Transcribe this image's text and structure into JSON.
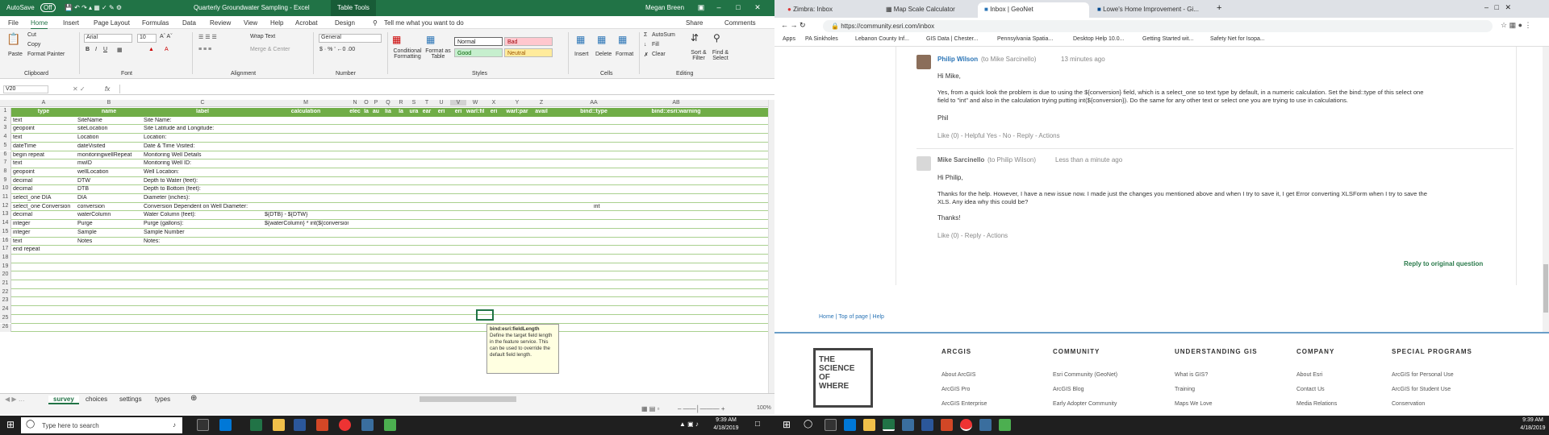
{
  "excel": {
    "autosave": "AutoSave",
    "autosave_state": "Off",
    "title": "Quarterly Groundwater Sampling - Excel",
    "context_tab": "Table Tools",
    "user": "Megan Breen",
    "menu": [
      "File",
      "Home",
      "Insert",
      "Page Layout",
      "Formulas",
      "Data",
      "Review",
      "View",
      "Help",
      "Acrobat",
      "Design"
    ],
    "tell_me": "Tell me what you want to do",
    "share": "Share",
    "comments": "Comments",
    "ribbon": {
      "paste": "Paste",
      "cut": "Cut",
      "copy": "Copy",
      "format_painter": "Format Painter",
      "clipboard": "Clipboard",
      "font_name": "Arial",
      "font_size": "10",
      "font": "Font",
      "wrap_text": "Wrap Text",
      "merge_center": "Merge & Center",
      "alignment": "Alignment",
      "number_format": "General",
      "number": "Number",
      "conditional": "Conditional Formatting",
      "format_as_table": "Format as Table",
      "normal": "Normal",
      "bad": "Bad",
      "good": "Good",
      "neutral": "Neutral",
      "styles": "Styles",
      "insert": "Insert",
      "delete": "Delete",
      "format": "Format",
      "cells": "Cells",
      "autosum": "AutoSum",
      "fill": "Fill",
      "clear": "Clear",
      "sort_filter": "Sort & Filter",
      "find_select": "Find & Select",
      "editing": "Editing"
    },
    "name_box": "V20",
    "fx": "fx",
    "columns": [
      "A",
      "B",
      "C",
      "M",
      "N",
      "O",
      "P",
      "Q",
      "R",
      "S",
      "T",
      "U",
      "V",
      "W",
      "X",
      "Y",
      "Z",
      "AA",
      "AB"
    ],
    "headers": [
      "type",
      "name",
      "label",
      "calculation",
      "elec",
      "la",
      "au",
      "lia",
      "la",
      "ura",
      "ear",
      "eri",
      "eri",
      "warl:fil",
      "eri",
      "warl:par",
      "avail",
      "bind::type",
      "bind::esri:warning"
    ],
    "rows": [
      {
        "n": "1",
        "a": "",
        "b": "",
        "c": "",
        "m": "",
        "aa": ""
      },
      {
        "n": "2",
        "a": "text",
        "b": "SiteName",
        "c": "Site Name:",
        "m": "",
        "aa": ""
      },
      {
        "n": "3",
        "a": "geopoint",
        "b": "siteLocation",
        "c": "Site Latitude and Longitude:",
        "m": "",
        "aa": ""
      },
      {
        "n": "4",
        "a": "text",
        "b": "Location",
        "c": "Location:",
        "m": "",
        "aa": ""
      },
      {
        "n": "5",
        "a": "dateTime",
        "b": "dateVisited",
        "c": "Date & Time Visited:",
        "m": "",
        "aa": ""
      },
      {
        "n": "6",
        "a": "begin repeat",
        "b": "monitoringwellRepeat",
        "c": "Monitoring Well Details",
        "m": "",
        "aa": ""
      },
      {
        "n": "7",
        "a": "text",
        "b": "mwID",
        "c": "Monitoring Well ID:",
        "m": "",
        "aa": ""
      },
      {
        "n": "8",
        "a": "geopoint",
        "b": "wellLocation",
        "c": "Well Location:",
        "m": "",
        "aa": ""
      },
      {
        "n": "9",
        "a": "decimal",
        "b": "DTW",
        "c": "Depth to Water (feet):",
        "m": "",
        "aa": ""
      },
      {
        "n": "10",
        "a": "decimal",
        "b": "DTB",
        "c": "Depth to Bottom (feet):",
        "m": "",
        "aa": ""
      },
      {
        "n": "11",
        "a": "select_one DIA",
        "b": "DIA",
        "c": "Diameter (inches):",
        "m": "",
        "aa": ""
      },
      {
        "n": "12",
        "a": "select_one Conversion",
        "b": "conversion",
        "c": "Conversion Dependent on Well Diameter:",
        "m": "",
        "aa": "int"
      },
      {
        "n": "13",
        "a": "decimal",
        "b": "waterColumn",
        "c": "Water Column (feet):",
        "m": "${DTB} - ${DTW}",
        "aa": ""
      },
      {
        "n": "14",
        "a": "integer",
        "b": "Purge",
        "c": "Purge (gallons):",
        "m": "${waterColumn} * int(${conversion})",
        "aa": ""
      },
      {
        "n": "15",
        "a": "integer",
        "b": "Sample",
        "c": "Sample Number",
        "m": "",
        "aa": ""
      },
      {
        "n": "16",
        "a": "text",
        "b": "Notes",
        "c": "Notes:",
        "m": "",
        "aa": ""
      },
      {
        "n": "17",
        "a": "end repeat",
        "b": "",
        "c": "",
        "m": "",
        "aa": ""
      },
      {
        "n": "18",
        "a": "",
        "b": "",
        "c": "",
        "m": "",
        "aa": ""
      },
      {
        "n": "19",
        "a": "",
        "b": "",
        "c": "",
        "m": "",
        "aa": ""
      },
      {
        "n": "20",
        "a": "",
        "b": "",
        "c": "",
        "m": "",
        "aa": ""
      },
      {
        "n": "21",
        "a": "",
        "b": "",
        "c": "",
        "m": "",
        "aa": ""
      },
      {
        "n": "22",
        "a": "",
        "b": "",
        "c": "",
        "m": "",
        "aa": ""
      },
      {
        "n": "23",
        "a": "",
        "b": "",
        "c": "",
        "m": "",
        "aa": ""
      },
      {
        "n": "24",
        "a": "",
        "b": "",
        "c": "",
        "m": "",
        "aa": ""
      },
      {
        "n": "25",
        "a": "",
        "b": "",
        "c": "",
        "m": "",
        "aa": ""
      },
      {
        "n": "26",
        "a": "",
        "b": "",
        "c": "",
        "m": "",
        "aa": ""
      }
    ],
    "tooltip_title": "bind:esri:fieldLength",
    "tooltip_body": "Define the target field length in the feature service. This can be used to override the default field length.",
    "sheets": [
      "survey",
      "choices",
      "settings",
      "types"
    ],
    "zoom": "100%"
  },
  "chrome": {
    "tabs": [
      "Zimbra: Inbox",
      "Map Scale Calculator",
      "Inbox | GeoNet",
      "Lowe's Home Improvement - Gi..."
    ],
    "url": "https://community.esri.com/inbox",
    "bookmarks": [
      "Apps",
      "PA Sinkholes",
      "Lebanon County Inf...",
      "GIS Data | Chester...",
      "Pennsylvania Spatia...",
      "Desktop Help 10.0...",
      "Getting Started wit...",
      "Safety Net for Isopa..."
    ],
    "post1": {
      "author": "Philip Wilson",
      "to": "(to Mike Sarcinello)",
      "time": "13 minutes ago",
      "greeting": "Hi Mike,",
      "body1": "Yes, from a quick look the problem is due to using the ${conversion} field, which is a select_one so text type by default, in a numeric calculation. Set the bind::type of this select one",
      "body2": "field to \"int\" and also in the calculation trying putting int(${conversion}). Do the same for any other text or select one you are trying to use in calculations.",
      "sign": "Phil",
      "actions": "Like (0) - Helpful Yes - No - Reply - Actions"
    },
    "post2": {
      "author": "Mike Sarcinello",
      "to": "(to Philip Wilson)",
      "time": "Less than a minute ago",
      "greeting": "Hi Philip,",
      "body1": "Thanks for the help. However, I have a new issue now. I made just the changes you mentioned above and when I try to save it, I get Error converting XLSForm when I try to save the",
      "body2": "XLS. Any idea why this could be?",
      "thanks": "Thanks!",
      "actions": "Like (0) - Reply - Actions"
    },
    "reply_original": "Reply to original question",
    "breadcrumb": "Home | Top of page | Help",
    "logo": [
      "THE",
      "SCIENCE",
      "OF",
      "WHERE"
    ],
    "footer": {
      "arcgis": {
        "head": "ARCGIS",
        "items": [
          "About ArcGIS",
          "ArcGIS Pro",
          "ArcGIS Enterprise"
        ]
      },
      "community": {
        "head": "COMMUNITY",
        "items": [
          "Esri Community (GeoNet)",
          "ArcGIS Blog",
          "Early Adopter Community"
        ]
      },
      "understanding": {
        "head": "UNDERSTANDING GIS",
        "items": [
          "What is GIS?",
          "Training",
          "Maps We Love"
        ]
      },
      "company": {
        "head": "COMPANY",
        "items": [
          "About Esri",
          "Contact Us",
          "Media Relations"
        ]
      },
      "special": {
        "head": "SPECIAL PROGRAMS",
        "items": [
          "ArcGIS for Personal Use",
          "ArcGIS for Student Use",
          "Conservation"
        ]
      }
    }
  },
  "taskbar": {
    "search": "Type here to search",
    "time1": "9:39 AM",
    "date1": "4/18/2019",
    "time2": "9:39 AM",
    "date2": "4/18/2019"
  }
}
